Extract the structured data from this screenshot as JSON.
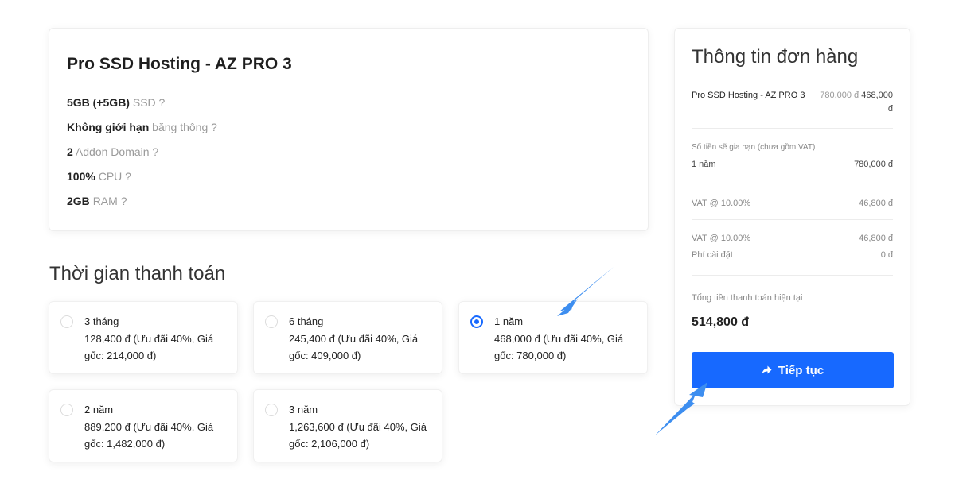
{
  "product": {
    "title": "Pro SSD Hosting - AZ PRO 3",
    "features": [
      {
        "value": "5GB (+5GB)",
        "label": "SSD ?"
      },
      {
        "value": "Không giới hạn",
        "label": "băng thông ?"
      },
      {
        "value": "2",
        "label": "Addon Domain ?"
      },
      {
        "value": "100%",
        "label": "CPU ?"
      },
      {
        "value": "2GB",
        "label": "RAM ?"
      }
    ]
  },
  "billing": {
    "heading": "Thời gian thanh toán",
    "options": [
      {
        "period": "3 tháng",
        "price": "128,400 đ (Ưu đãi 40%, Giá gốc: 214,000 đ)",
        "selected": false
      },
      {
        "period": "6 tháng",
        "price": "245,400 đ (Ưu đãi 40%, Giá gốc: 409,000 đ)",
        "selected": false
      },
      {
        "period": "1 năm",
        "price": "468,000 đ (Ưu đãi 40%, Giá gốc: 780,000 đ)",
        "selected": true
      },
      {
        "period": "2 năm",
        "price": "889,200 đ (Ưu đãi 40%, Giá gốc: 1,482,000 đ)",
        "selected": false
      },
      {
        "period": "3 năm",
        "price": "1,263,600 đ (Ưu đãi 40%, Giá gốc: 2,106,000 đ)",
        "selected": false
      }
    ]
  },
  "summary": {
    "title": "Thông tin đơn hàng",
    "product_name": "Pro SSD Hosting - AZ PRO 3",
    "old_price": "780,000 đ",
    "new_price": "468,000 đ",
    "renew_label": "Số tiền sẽ gia hạn (chưa gồm VAT)",
    "renew_period": "1 năm",
    "renew_amount": "780,000 đ",
    "vat1_label": "VAT @ 10.00%",
    "vat1_amount": "46,800 đ",
    "vat2_label": "VAT @ 10.00%",
    "vat2_amount": "46,800 đ",
    "setup_label": "Phí cài đặt",
    "setup_amount": "0 đ",
    "total_label": "Tổng tiền thanh toán hiện tại",
    "total_value": "514,800 đ",
    "continue_label": "Tiếp tục",
    "continue_icon": "share-arrow-icon"
  },
  "colors": {
    "accent": "#1769ff",
    "annotation_arrow": "#3d8ef0"
  }
}
